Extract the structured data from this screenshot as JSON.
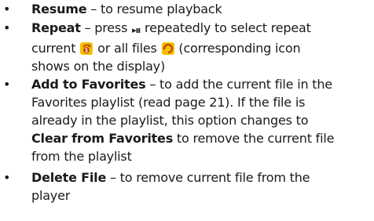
{
  "items": [
    {
      "term": "Resume",
      "desc": " – to resume playback"
    },
    {
      "term": "Repeat",
      "desc_1": " – press ",
      "ctrl_icon": "play-pause-icon",
      "ctrl_glyph": "▸ıı",
      "desc_2": " repeatedly to select repeat",
      "desc_3": "current ",
      "repeat_one_icon": "repeat-one-icon",
      "desc_4": " or all files ",
      "repeat_all_icon": "repeat-all-icon",
      "desc_5": " (corresponding icon",
      "desc_6": "shows on the display)"
    },
    {
      "term": "Add to Favorites",
      "desc_1": " – to add the current file in the",
      "line_2": "Favorites playlist (read page 21). If the file is",
      "line_3": "already in the playlist, this option changes to",
      "term_2": "Clear from Favorites",
      "desc_4": " to remove the current file",
      "line_5": "from the playlist"
    },
    {
      "term": "Delete File",
      "desc_1": " – to remove current file from the",
      "line_2": "player"
    }
  ],
  "colors": {
    "icon_bg": "#f2c200",
    "icon_fg": "#ffffff",
    "icon_accent": "#c94a00"
  }
}
